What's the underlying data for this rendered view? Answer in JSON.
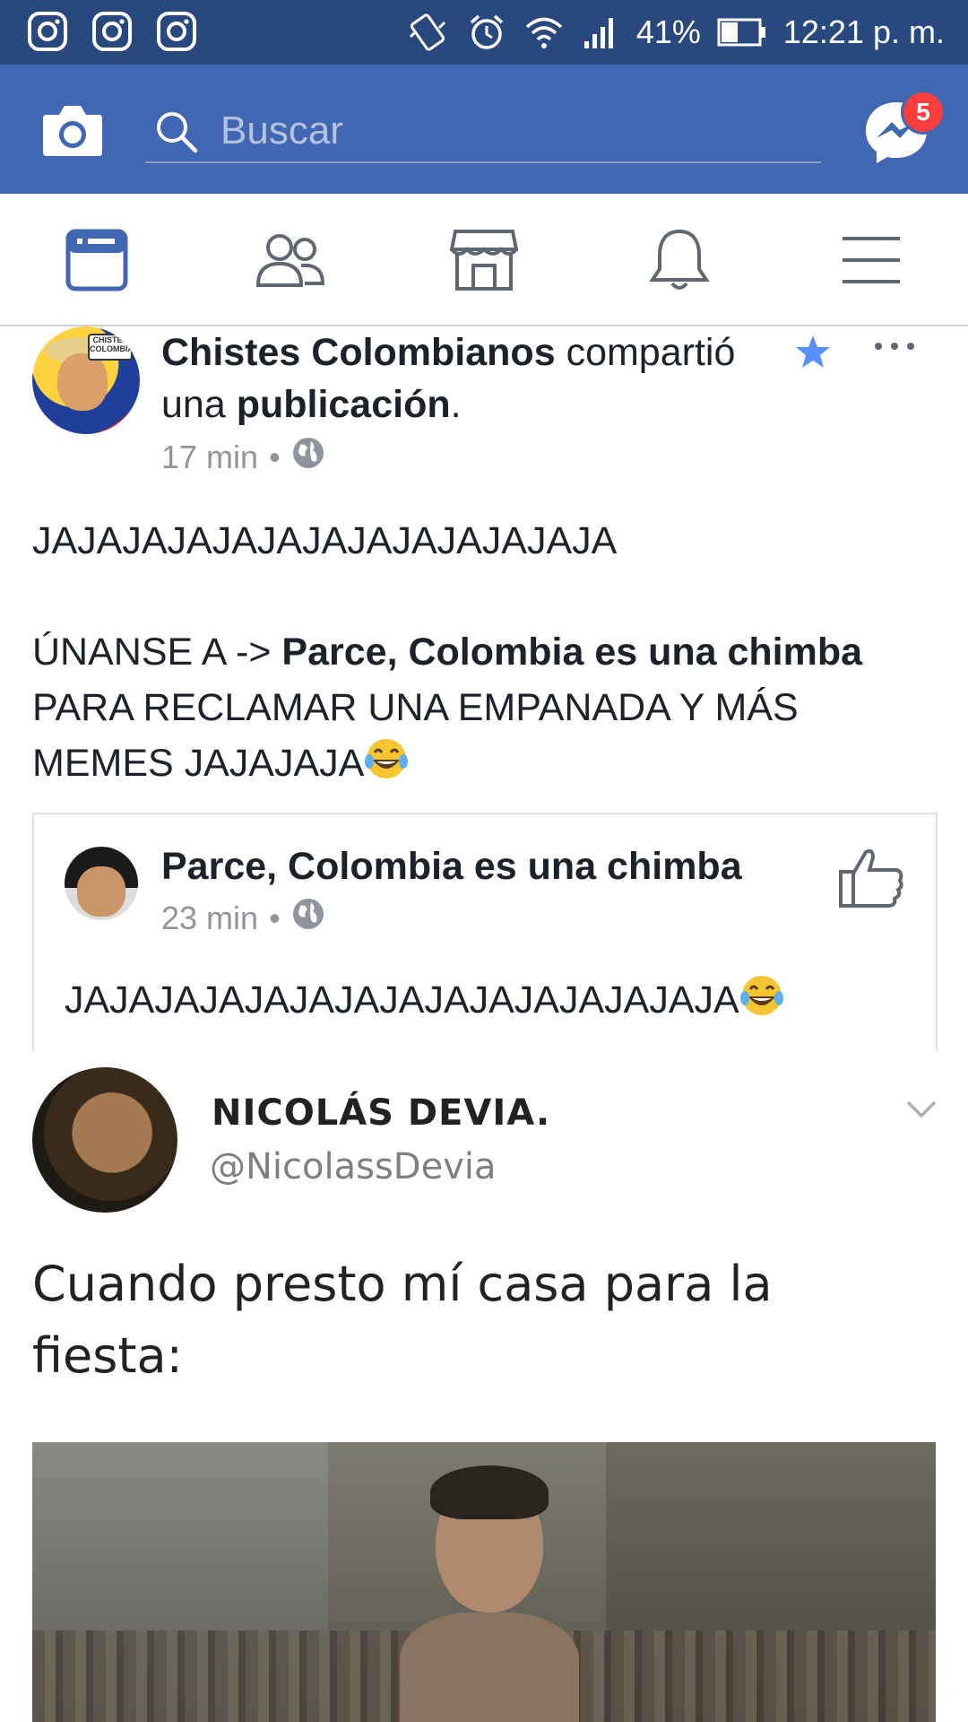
{
  "status_bar": {
    "left_icons": [
      "instagram-icon",
      "instagram-icon",
      "instagram-icon"
    ],
    "right_icons": [
      "vibrate-icon",
      "alarm-icon",
      "wifi-icon",
      "signal-icon",
      "battery-icon"
    ],
    "battery": "41%",
    "time": "12:21 p. m."
  },
  "header": {
    "search_placeholder": "Buscar",
    "messenger_badge": "5"
  },
  "nav_tabs": [
    {
      "name": "news-feed",
      "icon": "news-feed-icon",
      "active": true
    },
    {
      "name": "friends",
      "icon": "friends-icon",
      "active": false
    },
    {
      "name": "marketplace",
      "icon": "marketplace-icon",
      "active": false
    },
    {
      "name": "notifications",
      "icon": "bell-icon",
      "active": false
    },
    {
      "name": "menu",
      "icon": "menu-icon",
      "active": false
    }
  ],
  "post": {
    "author": "Chistes Colombianos",
    "action_word": " compartió",
    "action_rest": "una ",
    "action_bold": "publicación",
    "action_end": ".",
    "avatar_tag": "CHISTES COLOMBIANOS",
    "time": "17 min",
    "separator": "•",
    "body_line1": "JAJAJAJAJAJAJAJAJAJAJAJAJA",
    "body_p2_start": "ÚNANSE A -> ",
    "body_p2_bold": "Parce, Colombia es una chimba",
    "body_p2_rest": "PARA RECLAMAR UNA EMPANADA Y MÁS MEMES JAJAJAJA"
  },
  "shared": {
    "name": "Parce, Colombia es una chimba",
    "time": "23 min",
    "separator": "•",
    "text": "JAJAJAJAJAJAJAJAJAJAJAJAJAJAJA"
  },
  "meme": {
    "tweet_name": "NICOLÁS DEVIA.",
    "tweet_handle": "@NicolassDevia",
    "tweet_text": "Cuando presto mí casa para la fiesta:"
  },
  "colors": {
    "status_bar": "#29487d",
    "header": "#4267b2",
    "active_tab": "#4267b2",
    "badge": "#fa3e3e",
    "meta_gray": "#90949c"
  }
}
